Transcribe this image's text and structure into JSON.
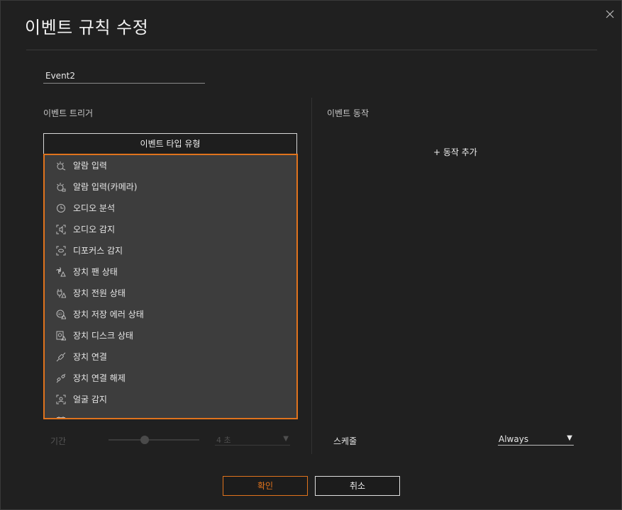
{
  "dialog": {
    "title": "이벤트 규칙 수정",
    "close_icon": "close-icon"
  },
  "rule_name": "Event2",
  "trigger": {
    "section_label": "이벤트 트리거",
    "type_button_label": "이벤트 타입 유형",
    "items": [
      {
        "label": "알람 입력",
        "icon": "alarm-input-icon"
      },
      {
        "label": "알람 입력(카메라)",
        "icon": "alarm-input-camera-icon"
      },
      {
        "label": "오디오 분석",
        "icon": "audio-analysis-icon"
      },
      {
        "label": "오디오 감지",
        "icon": "audio-detect-icon"
      },
      {
        "label": "디포커스 감지",
        "icon": "defocus-detect-icon"
      },
      {
        "label": "장치 팬 상태",
        "icon": "fan-status-icon"
      },
      {
        "label": "장치 전원 상태",
        "icon": "power-status-icon"
      },
      {
        "label": "장치 저장 에러 상태",
        "icon": "storage-error-icon"
      },
      {
        "label": "장치 디스크 상태",
        "icon": "disk-status-icon"
      },
      {
        "label": "장치 연결",
        "icon": "connect-icon"
      },
      {
        "label": "장치 연결 해제",
        "icon": "disconnect-icon"
      },
      {
        "label": "얼굴 감지",
        "icon": "face-detect-icon"
      },
      {
        "label": "",
        "icon": "calendar-icon"
      }
    ],
    "duration": {
      "label": "기간",
      "slider_position": 0.4,
      "value": "4 초"
    }
  },
  "action": {
    "section_label": "이벤트 동작",
    "add_label": "+ 동작 추가",
    "schedule_label": "스케줄",
    "schedule_value": "Always"
  },
  "buttons": {
    "ok_label": "확인",
    "cancel_label": "취소"
  },
  "colors": {
    "accent": "#e0731d",
    "background": "#202020",
    "dropdown_bg": "#3d3d3d"
  }
}
